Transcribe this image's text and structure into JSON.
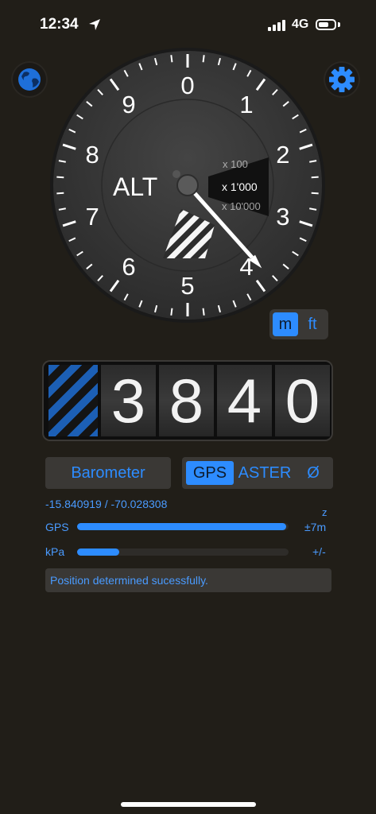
{
  "status_bar": {
    "time": "12:34",
    "network": "4G"
  },
  "icons": {
    "globe": "globe-icon",
    "settings": "gear-icon",
    "location": "location-arrow-icon"
  },
  "gauge": {
    "label": "ALT",
    "numerals": [
      "0",
      "1",
      "2",
      "3",
      "4",
      "5",
      "6",
      "7",
      "8",
      "9"
    ],
    "multipliers": [
      "x 100",
      "x 1'000",
      "x 10'000"
    ],
    "needle_value": 3840,
    "needle_full_scale": 10000
  },
  "units": {
    "options": [
      "m",
      "ft"
    ],
    "selected": "m"
  },
  "altitude_counter": {
    "digits": [
      "3",
      "8",
      "4",
      "0"
    ]
  },
  "barometer_button": "Barometer",
  "sources": {
    "options": [
      "GPS",
      "ASTER",
      "Ø"
    ],
    "selected": "GPS"
  },
  "coordinates": "-15.840919 / -70.028308",
  "z_label": "z",
  "rows": [
    {
      "label": "GPS",
      "value": "±7m",
      "fill": 0.99
    },
    {
      "label": "kPa",
      "value": "+/-",
      "fill": 0.2
    }
  ],
  "message": "Position determined sucessfully.",
  "colors": {
    "accent": "#2d8cff",
    "background": "#211e18",
    "dial": "#3a3a3a"
  }
}
